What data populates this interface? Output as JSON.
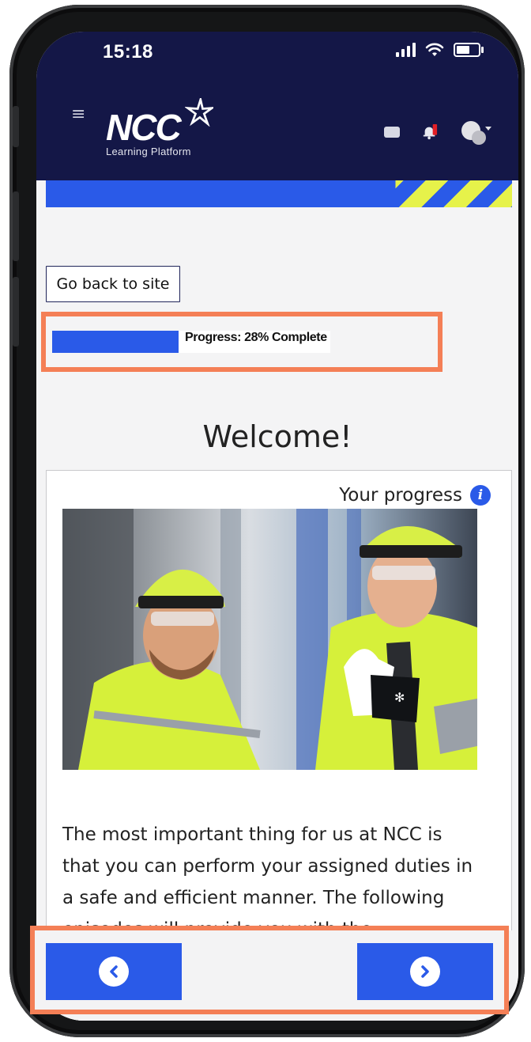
{
  "status_bar": {
    "time": "15:18"
  },
  "header": {
    "logo_text": "NCC",
    "logo_subtitle": "Learning Platform",
    "brand_colors": {
      "navy": "#141747",
      "blue": "#2a5ae8",
      "yellow": "#e6f24a",
      "alert_red": "#e21f26"
    }
  },
  "nav": {
    "back_label": "Go back to site"
  },
  "progress": {
    "percent": 28,
    "label": "Progress: 28% Complete"
  },
  "main": {
    "title": "Welcome!",
    "your_progress_label": "Your progress",
    "info_icon": "i",
    "body_text": "The most important thing for us at NCC is that you can perform your assigned duties in a safe and efficient manner. The following episodes will provide you with the information"
  },
  "pager": {
    "prev_icon": "chevron-left-icon",
    "next_icon": "chevron-right-icon"
  },
  "highlight_color": "#f47f56"
}
